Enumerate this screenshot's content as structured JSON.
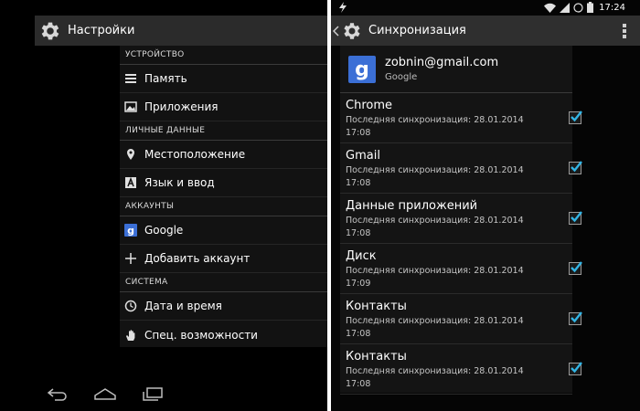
{
  "left": {
    "title": "Настройки",
    "sections": [
      {
        "header": "УСТРОЙСТВО",
        "items": [
          {
            "label": "Память",
            "icon": "storage-icon"
          },
          {
            "label": "Приложения",
            "icon": "apps-icon"
          }
        ]
      },
      {
        "header": "ЛИЧНЫЕ ДАННЫЕ",
        "items": [
          {
            "label": "Местоположение",
            "icon": "location-icon"
          },
          {
            "label": "Язык и ввод",
            "icon": "language-icon"
          }
        ]
      },
      {
        "header": "АККАУНТЫ",
        "items": [
          {
            "label": "Google",
            "icon": "google-icon"
          },
          {
            "label": "Добавить аккаунт",
            "icon": "plus-icon"
          }
        ]
      },
      {
        "header": "СИСТЕМА",
        "items": [
          {
            "label": "Дата и время",
            "icon": "clock-icon"
          },
          {
            "label": "Спец. возможности",
            "icon": "hand-icon"
          }
        ]
      }
    ],
    "navbar": [
      "back-icon",
      "home-icon",
      "recents-icon"
    ]
  },
  "right": {
    "status": {
      "time": "17:24"
    },
    "title": "Синхронизация",
    "account": {
      "email": "zobnin@gmail.com",
      "provider": "Google"
    },
    "sync_items": [
      {
        "name": "Chrome",
        "line1": "Последняя синхронизация: 28.01.2014",
        "line2": "17:08",
        "checked": true
      },
      {
        "name": "Gmail",
        "line1": "Последняя синхронизация: 28.01.2014",
        "line2": "17:08",
        "checked": true
      },
      {
        "name": "Данные приложений",
        "line1": "Последняя синхронизация: 28.01.2014",
        "line2": "17:08",
        "checked": true
      },
      {
        "name": "Диск",
        "line1": "Последняя синхронизация: 28.01.2014",
        "line2": "17:09",
        "checked": true
      },
      {
        "name": "Контакты",
        "line1": "Последняя синхронизация: 28.01.2014",
        "line2": "17:08",
        "checked": true
      },
      {
        "name": "Контакты",
        "line1": "Последняя синхронизация: 28.01.2014",
        "line2": "17:08",
        "checked": true
      }
    ]
  },
  "colors": {
    "google_blue": "#3b6fd6",
    "check_blue": "#33b5e5",
    "background": "#000000",
    "actionbar": "#2b2b2b"
  }
}
